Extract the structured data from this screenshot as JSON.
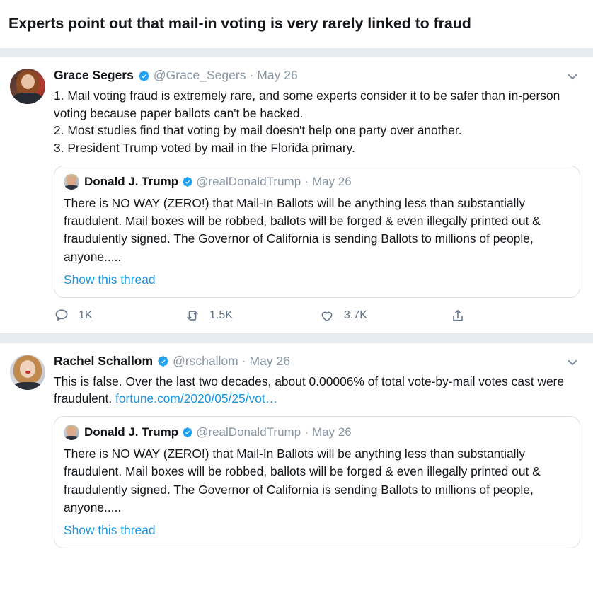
{
  "header": {
    "headline": "Experts point out that mail-in voting is very rarely linked to fraud"
  },
  "icons": {
    "verified": "verified-badge-icon",
    "caret": "chevron-down-icon",
    "reply": "reply-icon",
    "retweet": "retweet-icon",
    "like": "heart-icon",
    "share": "share-icon"
  },
  "colors": {
    "link": "#1b95e0",
    "verified_blue": "#1da1f2",
    "muted_text": "#8895a3",
    "action_text": "#63738a",
    "band": "#e7ecf1",
    "card_border": "#d9dfe4"
  },
  "quoted_tweet": {
    "display_name": "Donald J. Trump",
    "handle": "@realDonaldTrump",
    "separator": "·",
    "date": "May 26",
    "body": "There is NO WAY (ZERO!) that Mail-In Ballots will be anything less than substantially fraudulent. Mail boxes will be robbed, ballots will be forged & even illegally printed out & fraudulently signed. The Governor of California is sending Ballots to millions of people, anyone.....",
    "show_thread_label": "Show this thread"
  },
  "tweets": [
    {
      "display_name": "Grace Segers",
      "handle": "@Grace_Segers",
      "separator": "·",
      "date": "May 26",
      "verified": true,
      "body": "1. Mail voting fraud is extremely rare, and some experts consider it to be safer than in-person voting because paper ballots can't be hacked.\n2. Most studies find that voting by mail doesn't help one party over another.\n3. President Trump voted by mail in the Florida primary.",
      "actions": {
        "reply_count": "1K",
        "retweet_count": "1.5K",
        "like_count": "3.7K"
      }
    },
    {
      "display_name": "Rachel Schallom",
      "handle": "@rschallom",
      "separator": "·",
      "date": "May 26",
      "verified": true,
      "body_prefix": "This is false. Over the last two decades, about 0.00006% of total vote-by-mail votes cast were fraudulent. ",
      "body_link": "fortune.com/2020/05/25/vot…"
    }
  ]
}
